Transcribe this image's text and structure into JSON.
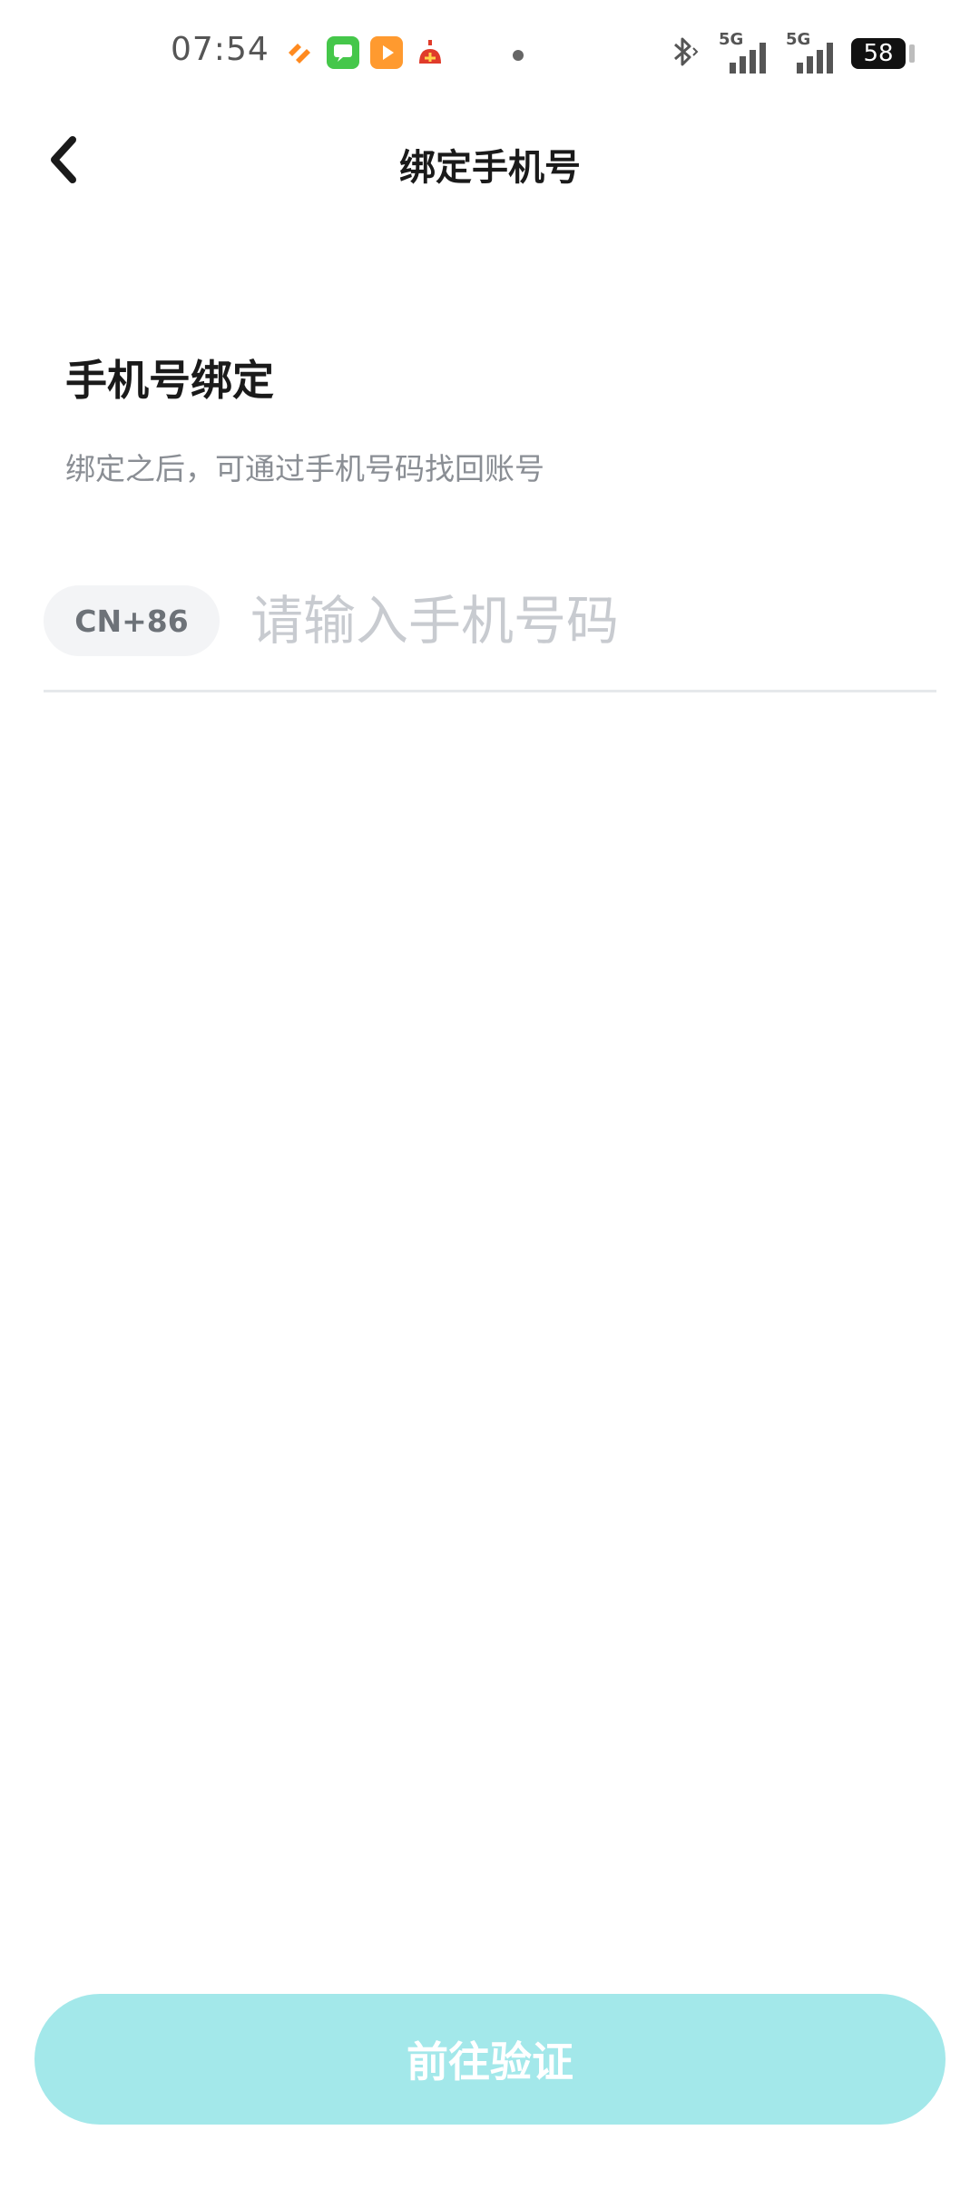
{
  "status_bar": {
    "time": "07:54",
    "signal1_label": "5G",
    "signal2_label": "5G",
    "battery": "58"
  },
  "nav": {
    "title": "绑定手机号"
  },
  "content": {
    "title": "手机号绑定",
    "subtitle": "绑定之后，可通过手机号码找回账号",
    "country_code": "CN+86",
    "phone_placeholder": "请输入手机号码",
    "phone_value": ""
  },
  "actions": {
    "verify_label": "前往验证"
  },
  "colors": {
    "button_bg": "#a3e8ea",
    "subtitle": "#8a8e94",
    "placeholder": "#c8cbd0"
  }
}
